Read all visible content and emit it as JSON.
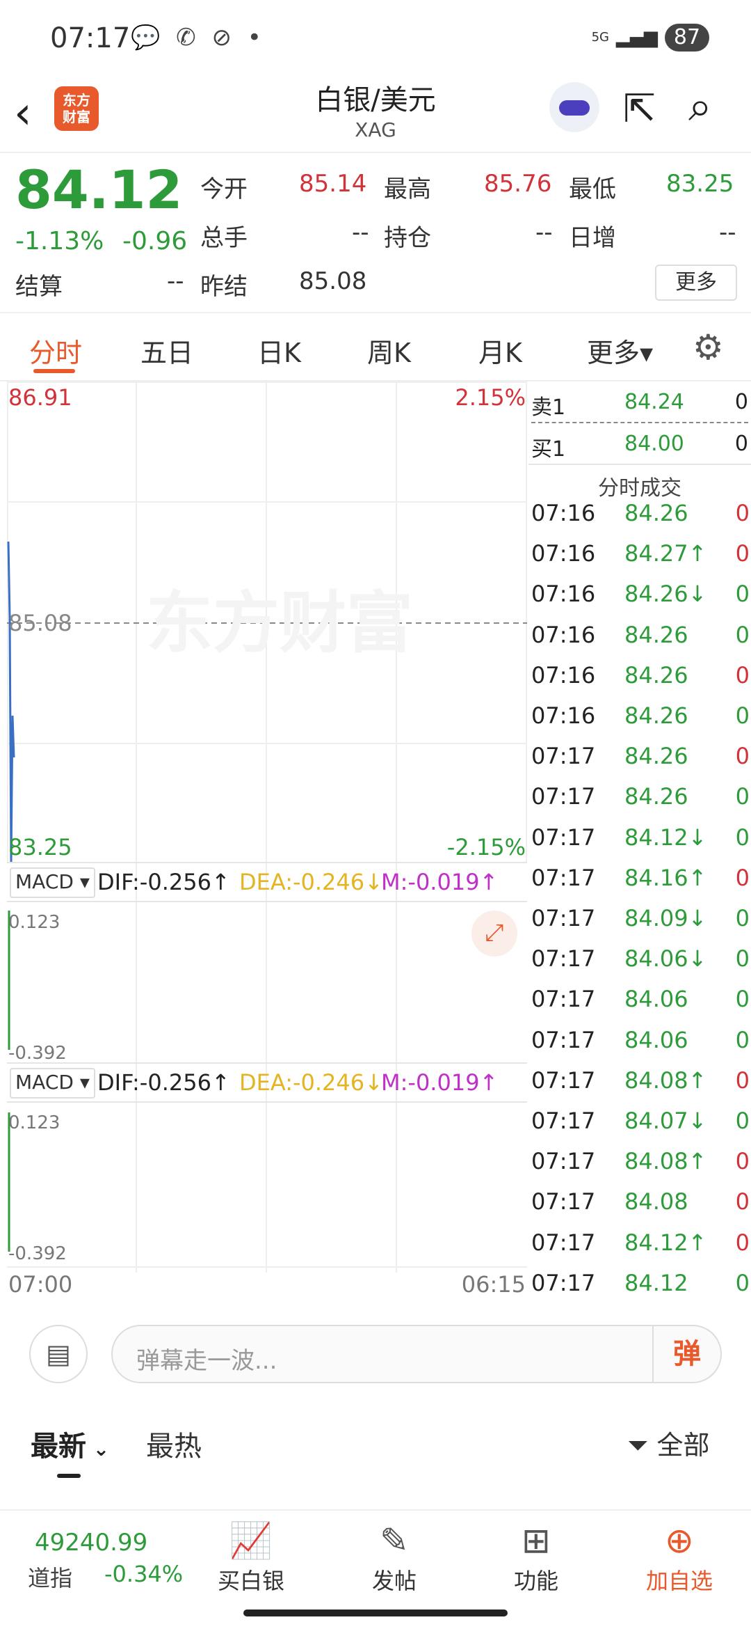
{
  "status": {
    "time": "07:17",
    "icons": "💬 ✆ ⊘ •",
    "network": "5G",
    "battery": "87"
  },
  "header": {
    "title": "白银/美元",
    "subtitle": "XAG",
    "logo_line1": "东方",
    "logo_line2": "财富"
  },
  "quote": {
    "price": "84.12",
    "change_pct": "-1.13%",
    "change": "-0.96",
    "open_label": "今开",
    "open": "85.14",
    "high_label": "最高",
    "high": "85.76",
    "low_label": "最低",
    "low": "83.25",
    "volume_label": "总手",
    "volume": "--",
    "position_label": "持仓",
    "position": "--",
    "daily_inc_label": "日增",
    "daily_inc": "--",
    "settle_label": "结算",
    "settle": "--",
    "prev_settle_label": "昨结",
    "prev_settle": "85.08",
    "more_label": "更多"
  },
  "tabs": [
    "分时",
    "五日",
    "日K",
    "周K",
    "月K",
    "更多▾"
  ],
  "chart": {
    "y_high": "86.91",
    "y_high_pct": "2.15%",
    "y_mid": "85.08",
    "y_low": "83.25",
    "y_low_pct": "-2.15%",
    "watermark": "东方财富",
    "x_start": "07:00",
    "x_end": "06:15",
    "macd_panels": [
      {
        "selector": "MACD",
        "dif": "DIF:-0.256↑",
        "dea": "DEA:-0.246↓",
        "m": "M:-0.019↑",
        "top": "0.123",
        "bottom": "-0.392"
      },
      {
        "selector": "MACD",
        "dif": "DIF:-0.256↑",
        "dea": "DEA:-0.246↓",
        "m": "M:-0.019↑",
        "top": "0.123",
        "bottom": "-0.392"
      }
    ]
  },
  "orderbook": {
    "ask_label": "卖1",
    "ask_price": "84.24",
    "ask_vol": "0",
    "bid_label": "买1",
    "bid_price": "84.00",
    "bid_vol": "0",
    "trades_title": "分时成交"
  },
  "trades": [
    {
      "t": "07:16",
      "p": "84.26",
      "v": "0",
      "vc": "red"
    },
    {
      "t": "07:16",
      "p": "84.27↑",
      "v": "0",
      "vc": "red"
    },
    {
      "t": "07:16",
      "p": "84.26↓",
      "v": "0",
      "vc": "green"
    },
    {
      "t": "07:16",
      "p": "84.26",
      "v": "0",
      "vc": "green"
    },
    {
      "t": "07:16",
      "p": "84.26",
      "v": "0",
      "vc": "red"
    },
    {
      "t": "07:16",
      "p": "84.26",
      "v": "0",
      "vc": "green"
    },
    {
      "t": "07:17",
      "p": "84.26",
      "v": "0",
      "vc": "red"
    },
    {
      "t": "07:17",
      "p": "84.26",
      "v": "0",
      "vc": "green"
    },
    {
      "t": "07:17",
      "p": "84.12↓",
      "v": "0",
      "vc": "green"
    },
    {
      "t": "07:17",
      "p": "84.16↑",
      "v": "0",
      "vc": "red"
    },
    {
      "t": "07:17",
      "p": "84.09↓",
      "v": "0",
      "vc": "green"
    },
    {
      "t": "07:17",
      "p": "84.06↓",
      "v": "0",
      "vc": "green"
    },
    {
      "t": "07:17",
      "p": "84.06",
      "v": "0",
      "vc": "green"
    },
    {
      "t": "07:17",
      "p": "84.06",
      "v": "0",
      "vc": "green"
    },
    {
      "t": "07:17",
      "p": "84.08↑",
      "v": "0",
      "vc": "red"
    },
    {
      "t": "07:17",
      "p": "84.07↓",
      "v": "0",
      "vc": "green"
    },
    {
      "t": "07:17",
      "p": "84.08↑",
      "v": "0",
      "vc": "red"
    },
    {
      "t": "07:17",
      "p": "84.08",
      "v": "0",
      "vc": "red"
    },
    {
      "t": "07:17",
      "p": "84.12↑",
      "v": "0",
      "vc": "red"
    },
    {
      "t": "07:17",
      "p": "84.12",
      "v": "0",
      "vc": "green"
    }
  ],
  "danmu": {
    "placeholder": "弹幕走一波...",
    "button": "弹"
  },
  "feed": {
    "tab_latest": "最新",
    "tab_hot": "最热",
    "filter": "全部"
  },
  "bottom": {
    "index_value": "49240.99",
    "index_name": "道指",
    "index_change": "-0.34%",
    "nav": [
      {
        "label": "买白银",
        "icon": "📈"
      },
      {
        "label": "发帖",
        "icon": "✎"
      },
      {
        "label": "功能",
        "icon": "⊞"
      },
      {
        "label": "加自选",
        "icon": "⊕"
      }
    ]
  },
  "colors": {
    "up": "#d2323a",
    "down": "#2e9b3b",
    "accent": "#e8592b"
  }
}
